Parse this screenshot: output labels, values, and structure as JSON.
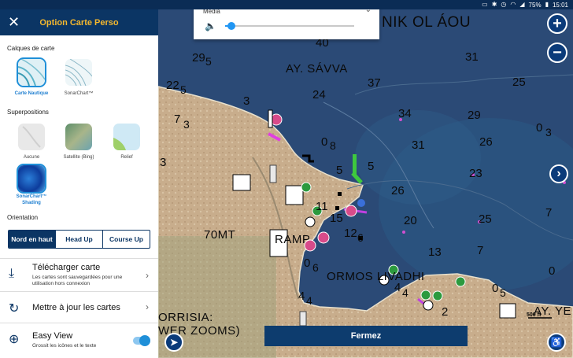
{
  "status_bar": {
    "battery": "75%",
    "time": "15:01",
    "icons": [
      "cast-icon",
      "bluetooth-icon",
      "alarm-icon",
      "wifi-icon",
      "signal-icon",
      "battery-icon"
    ]
  },
  "panel": {
    "title": "Option Carte Perso",
    "close_icon": "close-icon",
    "layers_label": "Calques de carte",
    "layers": [
      {
        "label": "Carte Nautique",
        "selected": true
      },
      {
        "label": "SonarChart™",
        "selected": false
      }
    ],
    "overlays_label": "Superpositions",
    "overlays": [
      {
        "label": "Aucune",
        "selected": false
      },
      {
        "label": "Satellite (Bing)",
        "selected": false
      },
      {
        "label": "Relief",
        "selected": false
      },
      {
        "label": "SonarChart™ Shading",
        "selected": true
      }
    ],
    "orientation_label": "Orientation",
    "orientation": [
      {
        "label": "Nord en haut",
        "active": true
      },
      {
        "label": "Head Up",
        "active": false
      },
      {
        "label": "Course Up",
        "active": false
      }
    ],
    "download": {
      "title": "Télécharger carte",
      "subtitle": "Les cartes sont sauvegardées pour une utilisation hors connexion",
      "icon": "download-icon"
    },
    "update": {
      "title": "Mettre à jour les cartes",
      "icon": "refresh-icon"
    },
    "easy_view": {
      "title": "Easy View",
      "subtitle": "Grossit les icônes et le texte",
      "icon": "zoom-in-icon",
      "enabled": true
    }
  },
  "media": {
    "title": "Média",
    "volume": 0.05,
    "icon": "volume-icon"
  },
  "map": {
    "places": [
      {
        "text": "NIK OL ÁOU",
        "big": true
      },
      {
        "text": "AY. SÁVVA"
      },
      {
        "text": "ORMOS LIVADHI"
      },
      {
        "text": "70MT"
      },
      {
        "text": "RAMP"
      },
      {
        "text": "ORRISIA:"
      },
      {
        "text": "WER ZOOMS)"
      },
      {
        "text": "AY. YE"
      }
    ],
    "depths": [
      "40",
      "31",
      "29",
      "5",
      "25",
      "22",
      "5",
      "37",
      "3",
      "24",
      "7",
      "3",
      "34",
      "29",
      "0",
      "8",
      "31",
      "26",
      "0",
      "3",
      "5",
      "5",
      "26",
      "3",
      "23",
      "20",
      "15",
      "12",
      "6",
      "25",
      "7",
      "13",
      "7",
      "0",
      "6",
      "4",
      "4",
      "4",
      "2",
      "0",
      "5",
      "0",
      "4",
      "11"
    ],
    "scale": "500 ft",
    "fermez_label": "Fermez"
  }
}
